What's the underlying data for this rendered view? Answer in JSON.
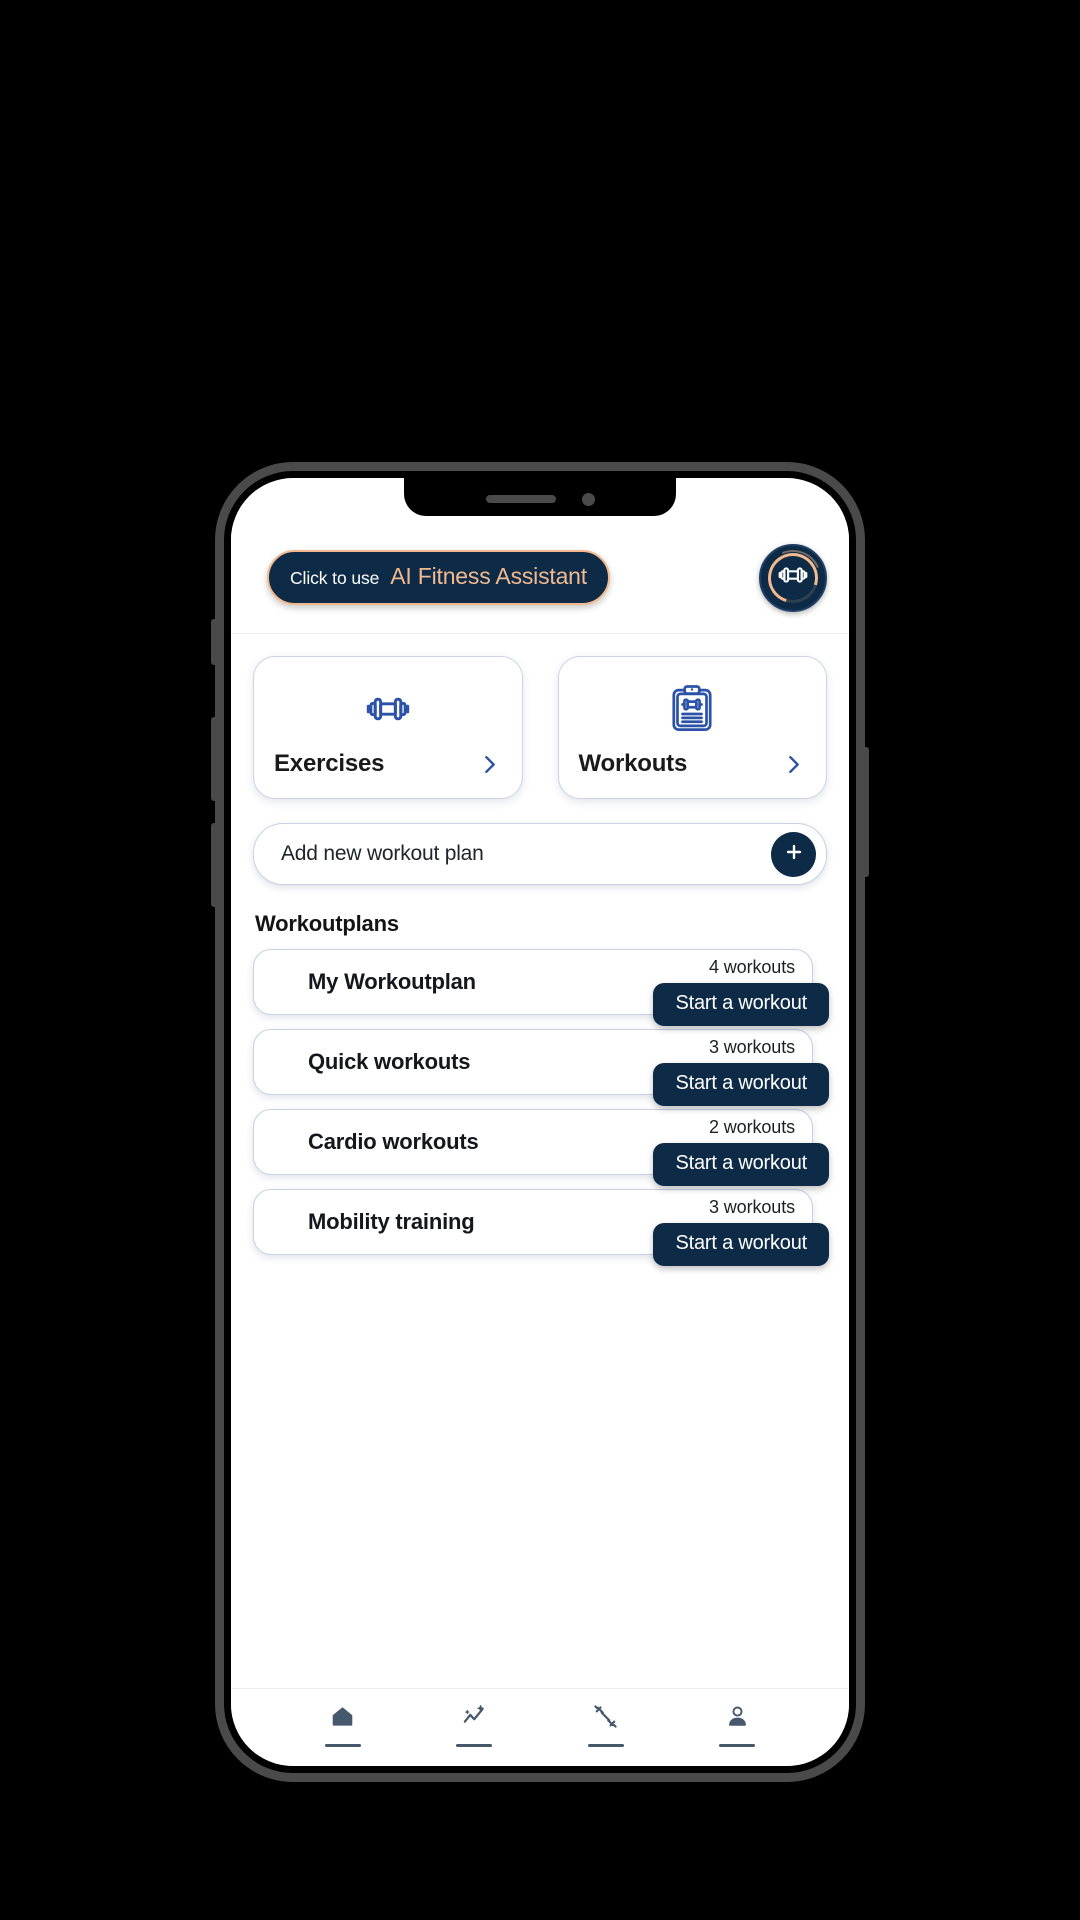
{
  "app": {
    "name": "Fitness App",
    "colors": {
      "navy": "#0d2b47",
      "peach": "#f3b98e",
      "blue_icon": "#2b52a8",
      "card_border": "#c9d1e4",
      "nav_icon": "#46586b",
      "page_bg": "#ffffff",
      "outside_bg": "#000000"
    }
  },
  "header": {
    "ai_button": {
      "prefix_label": "Click to use",
      "main_label": "AI Fitness Assistant"
    },
    "logo": {
      "icon": "dumbbell-icon",
      "alt": "app-logo"
    }
  },
  "nav_cards": [
    {
      "label": "Exercises",
      "icon": "dumbbell-icon",
      "chevron": "chevron-right-icon"
    },
    {
      "label": "Workouts",
      "icon": "clipboard-dumbbell-icon",
      "chevron": "chevron-right-icon"
    }
  ],
  "add_plan": {
    "label": "Add new workout plan",
    "button_icon": "plus-icon"
  },
  "workoutplans": {
    "section_title": "Workoutplans",
    "start_button_label": "Start a workout",
    "items": [
      {
        "name": "My Workoutplan",
        "count_label": "4 workouts",
        "count": 4
      },
      {
        "name": "Quick workouts",
        "count_label": "3 workouts",
        "count": 3
      },
      {
        "name": "Cardio workouts",
        "count_label": "2 workouts",
        "count": 2
      },
      {
        "name": "Mobility training",
        "count_label": "3 workouts",
        "count": 3
      }
    ]
  },
  "bottom_nav": {
    "items": [
      {
        "name": "home",
        "icon": "home-icon"
      },
      {
        "name": "stats",
        "icon": "sparkle-chart-icon"
      },
      {
        "name": "training",
        "icon": "diagonal-dumbbell-icon"
      },
      {
        "name": "profile",
        "icon": "person-icon"
      }
    ]
  }
}
